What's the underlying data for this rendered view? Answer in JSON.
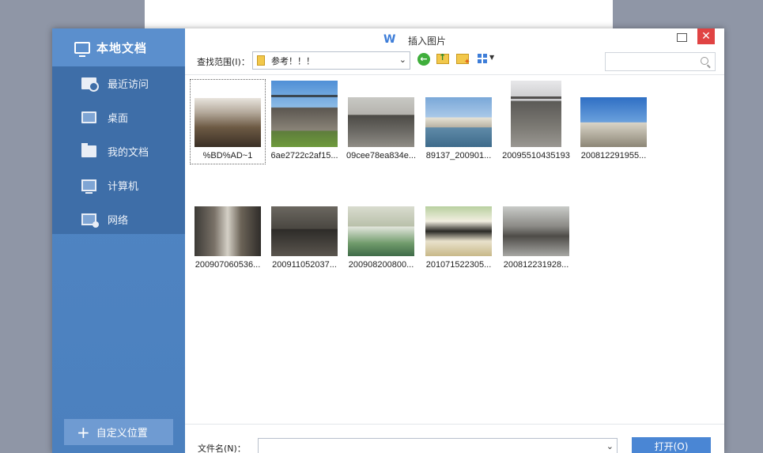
{
  "sidebar": {
    "title": "本地文档",
    "items": [
      {
        "label": "最近访问",
        "icon": "recent-icon"
      },
      {
        "label": "桌面",
        "icon": "desktop-icon"
      },
      {
        "label": "我的文档",
        "icon": "documents-icon"
      },
      {
        "label": "计算机",
        "icon": "computer-icon"
      },
      {
        "label": "网络",
        "icon": "network-icon"
      }
    ],
    "custom_button": "自定义位置"
  },
  "titlebar": {
    "title": "插入图片",
    "app_icon": "W"
  },
  "toolbar": {
    "lookin_label": "查找范围(I)：",
    "lookin_value": "参考！！！",
    "search_placeholder": ""
  },
  "files": [
    {
      "name": "%BD%AD~1"
    },
    {
      "name": "6ae2722c2af15..."
    },
    {
      "name": "09cee78ea834e..."
    },
    {
      "name": "89137_200901..."
    },
    {
      "name": "20095510435193"
    },
    {
      "name": "200812291955..."
    },
    {
      "name": "200907060536..."
    },
    {
      "name": "200911052037..."
    },
    {
      "name": "200908200800..."
    },
    {
      "name": "201071522305..."
    },
    {
      "name": "200812231928..."
    }
  ],
  "footer": {
    "filename_label": "文件名(N)：",
    "filename_value": "",
    "open_button": "打开(O)"
  }
}
